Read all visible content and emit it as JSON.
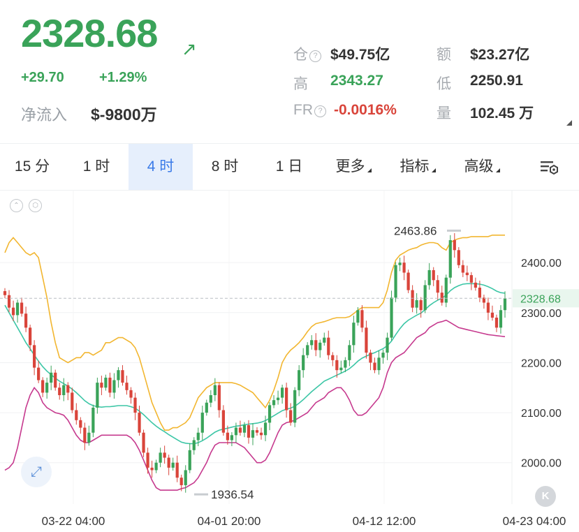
{
  "header": {
    "price": "2328.68",
    "change_abs": "+29.70",
    "change_pct": "+1.29%",
    "net_inflow_label": "净流入",
    "net_inflow_value": "$-9800万",
    "oi_label": "仓",
    "oi_value": "$49.75亿",
    "turnover_label": "额",
    "turnover_value": "$23.27亿",
    "high_label": "高",
    "high_value": "2343.27",
    "low_label": "低",
    "low_value": "2250.91",
    "fr_label": "FR",
    "fr_value": "-0.0016%",
    "volume_label": "量",
    "volume_value": "102.45 万",
    "colors": {
      "up": "#3aa359",
      "down": "#d9443a"
    }
  },
  "tabs": {
    "t15m": "15 分",
    "t1h": "1 时",
    "t4h": "4 时",
    "t8h": "8 时",
    "t1d": "1 日",
    "more": "更多",
    "indicators": "指标",
    "advanced": "高级",
    "active": "4 时"
  },
  "chart_data": {
    "type": "candlestick",
    "y_ticks": [
      "2400.00",
      "2300.00",
      "2200.00",
      "2100.00",
      "2000.00"
    ],
    "x_ticks": [
      "03-22 04:00",
      "04-01 20:00",
      "04-12 12:00",
      "04-23 04:00"
    ],
    "current_price_label": "2328.68",
    "max_label": "2463.86",
    "min_label": "1936.54",
    "ylim": [
      1920,
      2520
    ],
    "closes": [
      2335,
      2310,
      2295,
      2320,
      2298,
      2270,
      2235,
      2190,
      2165,
      2140,
      2160,
      2180,
      2150,
      2135,
      2155,
      2140,
      2105,
      2085,
      2070,
      2040,
      2060,
      2110,
      2160,
      2150,
      2170,
      2140,
      2165,
      2185,
      2160,
      2145,
      2130,
      2100,
      2060,
      2020,
      1990,
      1985,
      2000,
      2020,
      2010,
      1990,
      2000,
      1970,
      1955,
      1985,
      2025,
      2045,
      2060,
      2100,
      2120,
      2135,
      2155,
      2105,
      2060,
      2045,
      2055,
      2070,
      2060,
      2075,
      2050,
      2065,
      2060,
      2055,
      2080,
      2115,
      2125,
      2130,
      2150,
      2105,
      2080,
      2145,
      2185,
      2215,
      2235,
      2245,
      2225,
      2240,
      2250,
      2215,
      2205,
      2185,
      2190,
      2205,
      2235,
      2280,
      2305,
      2270,
      2220,
      2200,
      2185,
      2210,
      2220,
      2250,
      2330,
      2395,
      2400,
      2380,
      2345,
      2310,
      2325,
      2305,
      2355,
      2385,
      2365,
      2340,
      2320,
      2370,
      2445,
      2425,
      2395,
      2380,
      2375,
      2360,
      2350,
      2330,
      2320,
      2300,
      2290,
      2270,
      2305,
      2328.68
    ],
    "ma": [
      2315,
      2300,
      2285,
      2270,
      2255,
      2240,
      2228,
      2215,
      2203,
      2192,
      2183,
      2176,
      2169,
      2163,
      2158,
      2153,
      2147,
      2140,
      2132,
      2124,
      2118,
      2114,
      2112,
      2111,
      2112,
      2112,
      2113,
      2114,
      2114,
      2114,
      2112,
      2109,
      2103,
      2096,
      2088,
      2080,
      2073,
      2067,
      2062,
      2056,
      2051,
      2046,
      2041,
      2039,
      2038,
      2038,
      2040,
      2044,
      2049,
      2055,
      2061,
      2065,
      2067,
      2069,
      2071,
      2073,
      2074,
      2076,
      2077,
      2078,
      2079,
      2081,
      2084,
      2089,
      2094,
      2099,
      2104,
      2107,
      2109,
      2113,
      2119,
      2126,
      2134,
      2142,
      2149,
      2156,
      2163,
      2167,
      2171,
      2175,
      2179,
      2183,
      2188,
      2195,
      2203,
      2209,
      2213,
      2217,
      2220,
      2224,
      2228,
      2234,
      2243,
      2256,
      2268,
      2278,
      2285,
      2290,
      2295,
      2299,
      2306,
      2314,
      2320,
      2325,
      2329,
      2335,
      2344,
      2350,
      2354,
      2357,
      2358,
      2358,
      2358,
      2357,
      2355,
      2352,
      2348,
      2343,
      2340,
      2339
    ],
    "upper": [
      2420,
      2440,
      2450,
      2440,
      2430,
      2420,
      2415,
      2420,
      2410,
      2370,
      2330,
      2280,
      2240,
      2210,
      2205,
      2200,
      2205,
      2210,
      2210,
      2220,
      2220,
      2215,
      2220,
      2225,
      2240,
      2240,
      2245,
      2250,
      2250,
      2245,
      2240,
      2230,
      2210,
      2180,
      2150,
      2120,
      2100,
      2080,
      2065,
      2065,
      2070,
      2070,
      2075,
      2080,
      2090,
      2110,
      2130,
      2140,
      2150,
      2155,
      2160,
      2160,
      2160,
      2160,
      2160,
      2158,
      2155,
      2150,
      2145,
      2140,
      2130,
      2120,
      2110,
      2125,
      2145,
      2170,
      2200,
      2215,
      2225,
      2232,
      2240,
      2250,
      2262,
      2272,
      2278,
      2280,
      2282,
      2285,
      2288,
      2290,
      2290,
      2290,
      2292,
      2298,
      2305,
      2310,
      2310,
      2310,
      2310,
      2310,
      2320,
      2345,
      2380,
      2405,
      2415,
      2420,
      2425,
      2428,
      2430,
      2435,
      2438,
      2440,
      2440,
      2438,
      2430,
      2425,
      2440,
      2445,
      2448,
      2450,
      2450,
      2452,
      2452,
      2452,
      2452,
      2452,
      2455,
      2455,
      2455,
      2455
    ],
    "lower": [
      1985,
      1990,
      2000,
      2030,
      2070,
      2110,
      2135,
      2150,
      2140,
      2120,
      2110,
      2105,
      2100,
      2098,
      2095,
      2085,
      2070,
      2055,
      2045,
      2040,
      2040,
      2045,
      2050,
      2055,
      2055,
      2055,
      2055,
      2055,
      2055,
      2055,
      2050,
      2040,
      2025,
      2005,
      1985,
      1965,
      1950,
      1945,
      1945,
      1945,
      1945,
      1945,
      1948,
      1950,
      1955,
      1960,
      1970,
      1985,
      2000,
      2020,
      2035,
      2040,
      2040,
      2040,
      2040,
      2040,
      2035,
      2030,
      2020,
      2010,
      2000,
      2000,
      2005,
      2020,
      2040,
      2060,
      2075,
      2080,
      2082,
      2085,
      2090,
      2095,
      2100,
      2110,
      2120,
      2125,
      2130,
      2140,
      2145,
      2150,
      2150,
      2140,
      2125,
      2105,
      2095,
      2095,
      2100,
      2110,
      2120,
      2130,
      2150,
      2180,
      2200,
      2210,
      2215,
      2220,
      2230,
      2240,
      2250,
      2255,
      2260,
      2270,
      2275,
      2280,
      2282,
      2285,
      2280,
      2275,
      2270,
      2268,
      2266,
      2264,
      2262,
      2260,
      2258,
      2256,
      2255,
      2254,
      2253,
      2252
    ]
  }
}
